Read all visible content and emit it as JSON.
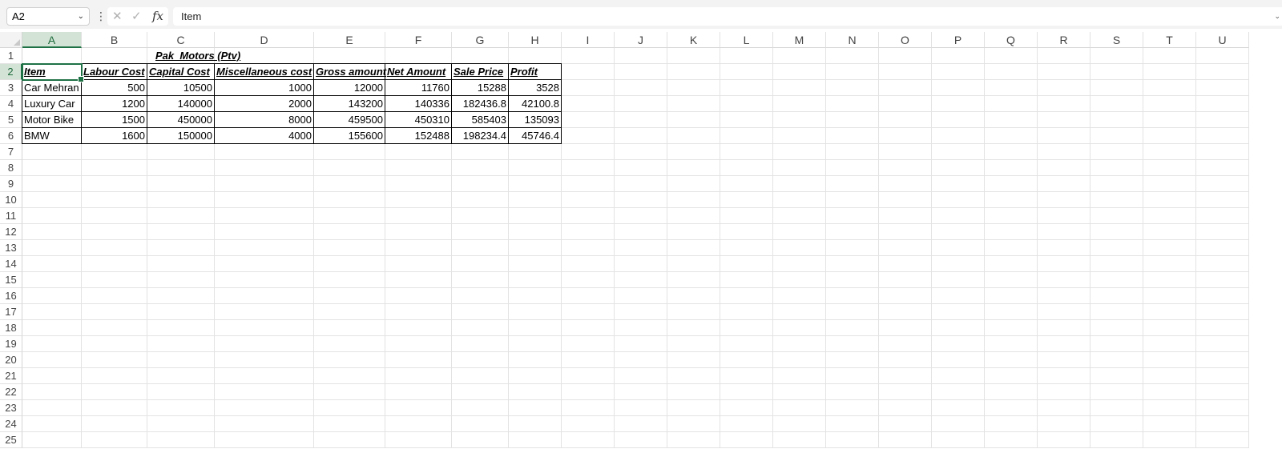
{
  "formula_bar": {
    "name_box": "A2",
    "formula": "Item",
    "cancel_icon": "x-icon",
    "confirm_icon": "check-icon",
    "fx_label": "fx"
  },
  "columns": [
    "A",
    "B",
    "C",
    "D",
    "E",
    "F",
    "G",
    "H",
    "I",
    "J",
    "K",
    "L",
    "M",
    "N",
    "O",
    "P",
    "Q",
    "R",
    "S",
    "T",
    "U"
  ],
  "rows": [
    "1",
    "2",
    "3",
    "4",
    "5",
    "6",
    "7",
    "8",
    "9",
    "10",
    "11",
    "12",
    "13",
    "14",
    "15",
    "16",
    "17",
    "18",
    "19",
    "20",
    "21",
    "22",
    "23",
    "24",
    "25"
  ],
  "sheet": {
    "title": "Pak_Motors (Ptv)",
    "headers": [
      "Item",
      "Labour Cost",
      "Capital Cost",
      "Miscellaneous cost",
      "Gross amount",
      "Net Amount",
      "Sale Price",
      "Profit"
    ],
    "data": [
      [
        "Car Mehran",
        "500",
        "10500",
        "1000",
        "12000",
        "11760",
        "15288",
        "3528"
      ],
      [
        "Luxury Car",
        "1200",
        "140000",
        "2000",
        "143200",
        "140336",
        "182436.8",
        "42100.8"
      ],
      [
        "Motor Bike",
        "1500",
        "450000",
        "8000",
        "459500",
        "450310",
        "585403",
        "135093"
      ],
      [
        "BMW",
        "1600",
        "150000",
        "4000",
        "155600",
        "152488",
        "198234.4",
        "45746.4"
      ]
    ]
  },
  "selection": {
    "column": "A",
    "row": "2"
  },
  "colors": {
    "accent": "#1e7145",
    "selected_header_bg": "#d3e3d5"
  }
}
